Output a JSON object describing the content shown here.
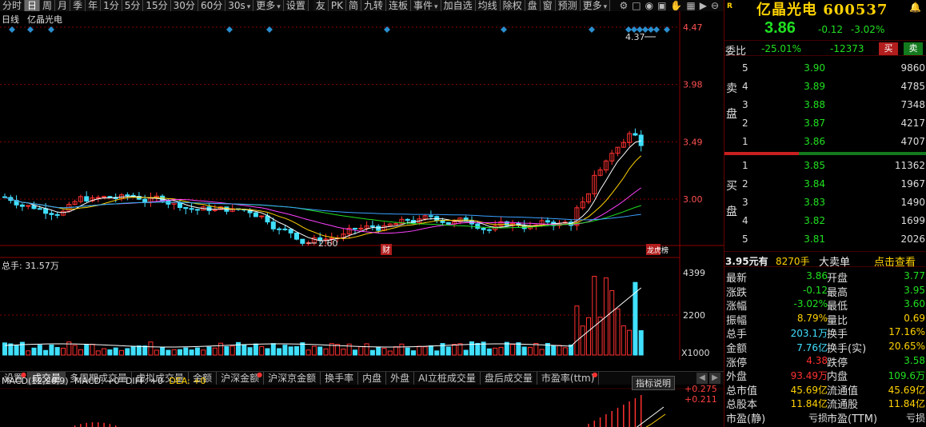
{
  "toolbar": {
    "items": [
      "分时",
      "日",
      "周",
      "月",
      "季",
      "年",
      "1分",
      "5分",
      "15分",
      "30分",
      "60分",
      "30s",
      "更多",
      "设置"
    ],
    "active": "日",
    "right_items": [
      "友",
      "PK",
      "简",
      "九转",
      "连板",
      "事件",
      "加自选",
      "均线",
      "除权",
      "盘",
      "窗",
      "预测",
      "更多"
    ]
  },
  "chart": {
    "period_label": "日线",
    "stock_name": "亿晶光电",
    "y_ticks": [
      "4.47",
      "3.98",
      "3.49",
      "3.00"
    ],
    "high_marker": "4.37",
    "low_marker": "2.60",
    "event_label_1": "财",
    "event_label_2": "龙虎榜"
  },
  "volume": {
    "title": "总手: 31.57万",
    "ticks": [
      "4399",
      "2200"
    ],
    "unit": "X1000"
  },
  "tabs": [
    {
      "label": "设置",
      "dot": true
    },
    {
      "label": "成交量",
      "dot": false,
      "active": true
    },
    {
      "label": "多周期成交量",
      "dot": false
    },
    {
      "label": "虚拟成交量",
      "dot": false
    },
    {
      "label": "金额",
      "dot": false
    },
    {
      "label": "沪深金额",
      "dot": true
    },
    {
      "label": "沪深京金额",
      "dot": false
    },
    {
      "label": "换手率",
      "dot": false
    },
    {
      "label": "内盘",
      "dot": false
    },
    {
      "label": "外盘",
      "dot": false
    },
    {
      "label": "AI立桩成交量",
      "dot": false
    },
    {
      "label": "盘后成交量",
      "dot": false
    },
    {
      "label": "市盈率(ttm)",
      "dot": true
    }
  ],
  "macd": {
    "title": "MACD(12,26,9)",
    "macd_label": "MACD: +0",
    "diff_label": "DIFF: +0",
    "dea_label": "DEA: +0",
    "explain_button": "指标说明",
    "ticks": [
      "+0.275",
      "+0.211"
    ]
  },
  "panel": {
    "badge": "R",
    "name": "亿晶光电",
    "code": "600537",
    "price": "3.86",
    "change": "-0.12",
    "change_pct": "-3.02%",
    "ratio_label": "委比",
    "ratio_pct": "-25.01%",
    "ratio_diff": "-12373",
    "buy_button": "买",
    "sell_button": "卖",
    "sell_side_label": [
      "卖",
      "盘"
    ],
    "buy_side_label": [
      "买",
      "盘"
    ],
    "asks": [
      {
        "level": "5",
        "price": "3.90",
        "volume": "9860"
      },
      {
        "level": "4",
        "price": "3.89",
        "volume": "4785"
      },
      {
        "level": "3",
        "price": "3.88",
        "volume": "7348"
      },
      {
        "level": "2",
        "price": "3.87",
        "volume": "4217"
      },
      {
        "level": "1",
        "price": "3.86",
        "volume": "4707"
      }
    ],
    "bids": [
      {
        "level": "1",
        "price": "3.85",
        "volume": "11362"
      },
      {
        "level": "2",
        "price": "3.84",
        "volume": "1967"
      },
      {
        "level": "3",
        "price": "3.83",
        "volume": "1490"
      },
      {
        "level": "4",
        "price": "3.82",
        "volume": "1699"
      },
      {
        "level": "5",
        "price": "3.81",
        "volume": "2026"
      }
    ],
    "trade_price": "3.95元有",
    "trade_volume": "8270手",
    "trade_label": "大卖单",
    "trade_link": "点击查看",
    "stats": [
      {
        "l1": "最新",
        "v1": "3.86",
        "c1": "#20e020",
        "l2": "开盘",
        "v2": "3.77",
        "c2": "#20e020"
      },
      {
        "l1": "涨跌",
        "v1": "-0.12",
        "c1": "#20e020",
        "l2": "最高",
        "v2": "3.95",
        "c2": "#20e020"
      },
      {
        "l1": "涨幅",
        "v1": "-3.02%",
        "c1": "#20e020",
        "l2": "最低",
        "v2": "3.60",
        "c2": "#20e020"
      },
      {
        "l1": "振幅",
        "v1": "8.79%",
        "c1": "#ffd200",
        "l2": "量比",
        "v2": "0.69",
        "c2": "#ffd200"
      },
      {
        "l1": "总手",
        "v1": "203.1万",
        "c1": "#40e0ff",
        "l2": "换手",
        "v2": "17.16%",
        "c2": "#ffd200"
      },
      {
        "l1": "金额",
        "v1": "7.76亿",
        "c1": "#40e0ff",
        "l2": "换手(实)",
        "v2": "20.65%",
        "c2": "#ffd200"
      },
      {
        "l1": "涨停",
        "v1": "4.38",
        "c1": "#ff3030",
        "l2": "跌停",
        "v2": "3.58",
        "c2": "#20e020"
      },
      {
        "l1": "外盘",
        "v1": "93.49万",
        "c1": "#ff3030",
        "l2": "内盘",
        "v2": "109.6万",
        "c2": "#20e020"
      },
      {
        "l1": "总市值",
        "v1": "45.69亿",
        "c1": "#ffd200",
        "l2": "流通值",
        "v2": "45.69亿",
        "c2": "#ffd200"
      },
      {
        "l1": "总股本",
        "v1": "11.84亿",
        "c1": "#ffd200",
        "l2": "流通股",
        "v2": "11.84亿",
        "c2": "#ffd200"
      },
      {
        "l1": "市盈(静)",
        "v1": "亏损",
        "c1": "#ddd",
        "l2": "市盈(TTM)",
        "v2": "亏损",
        "c2": "#ddd"
      }
    ]
  },
  "colors": {
    "up": "#ff3030",
    "down": "#20e020",
    "cyan": "#40e0ff",
    "yellow": "#ffd200",
    "grid_red": "#8a0000"
  }
}
